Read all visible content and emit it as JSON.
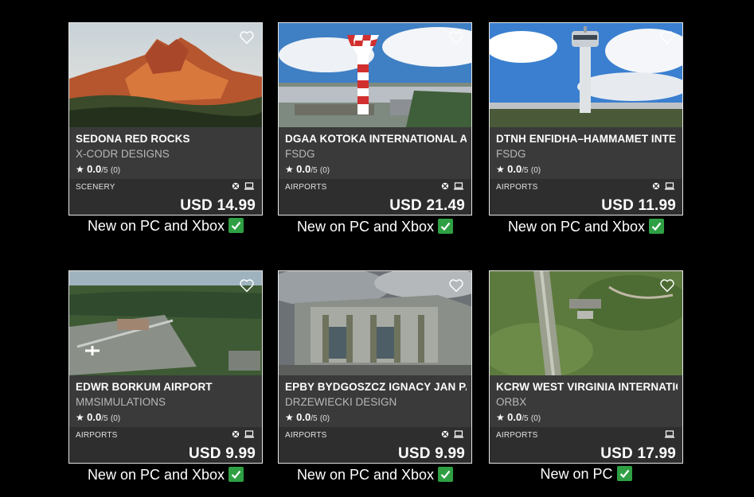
{
  "products": [
    {
      "title": "SEDONA RED ROCKS",
      "publisher": "X-CODR DESIGNS",
      "rating_score": "0.0",
      "rating_scale": "/5",
      "rating_count": "(0)",
      "category": "SCENERY",
      "platforms": [
        "xbox-icon",
        "pc-icon"
      ],
      "price": "USD 14.99",
      "caption": "New on PC and Xbox"
    },
    {
      "title": "DGAA KOTOKA INTERNATIONAL A",
      "publisher": "FSDG",
      "rating_score": "0.0",
      "rating_scale": "/5",
      "rating_count": "(0)",
      "category": "AIRPORTS",
      "platforms": [
        "xbox-icon",
        "pc-icon"
      ],
      "price": "USD 21.49",
      "caption": "New on PC and Xbox"
    },
    {
      "title": "DTNH ENFIDHA–HAMMAMET INTE",
      "publisher": "FSDG",
      "rating_score": "0.0",
      "rating_scale": "/5",
      "rating_count": "(0)",
      "category": "AIRPORTS",
      "platforms": [
        "xbox-icon",
        "pc-icon"
      ],
      "price": "USD 11.99",
      "caption": "New on PC and Xbox"
    },
    {
      "title": "EDWR BORKUM AIRPORT",
      "publisher": "MMSIMULATIONS",
      "rating_score": "0.0",
      "rating_scale": "/5",
      "rating_count": "(0)",
      "category": "AIRPORTS",
      "platforms": [
        "xbox-icon",
        "pc-icon"
      ],
      "price": "USD 9.99",
      "caption": "New on PC and Xbox"
    },
    {
      "title": "EPBY BYDGOSZCZ IGNACY JAN PA",
      "publisher": "DRZEWIECKI DESIGN",
      "rating_score": "0.0",
      "rating_scale": "/5",
      "rating_count": "(0)",
      "category": "AIRPORTS",
      "platforms": [
        "xbox-icon",
        "pc-icon"
      ],
      "price": "USD 9.99",
      "caption": "New on PC and Xbox"
    },
    {
      "title": "KCRW WEST VIRGINIA INTERNATIC",
      "publisher": "ORBX",
      "rating_score": "0.0",
      "rating_scale": "/5",
      "rating_count": "(0)",
      "category": "AIRPORTS",
      "platforms": [
        "pc-icon"
      ],
      "price": "USD 17.99",
      "caption": "New on PC"
    }
  ],
  "colors": {
    "background": "#000000",
    "card_info": "#3a3a3a",
    "card_bottom": "#2e2e2e",
    "check_green": "#2ea043"
  }
}
